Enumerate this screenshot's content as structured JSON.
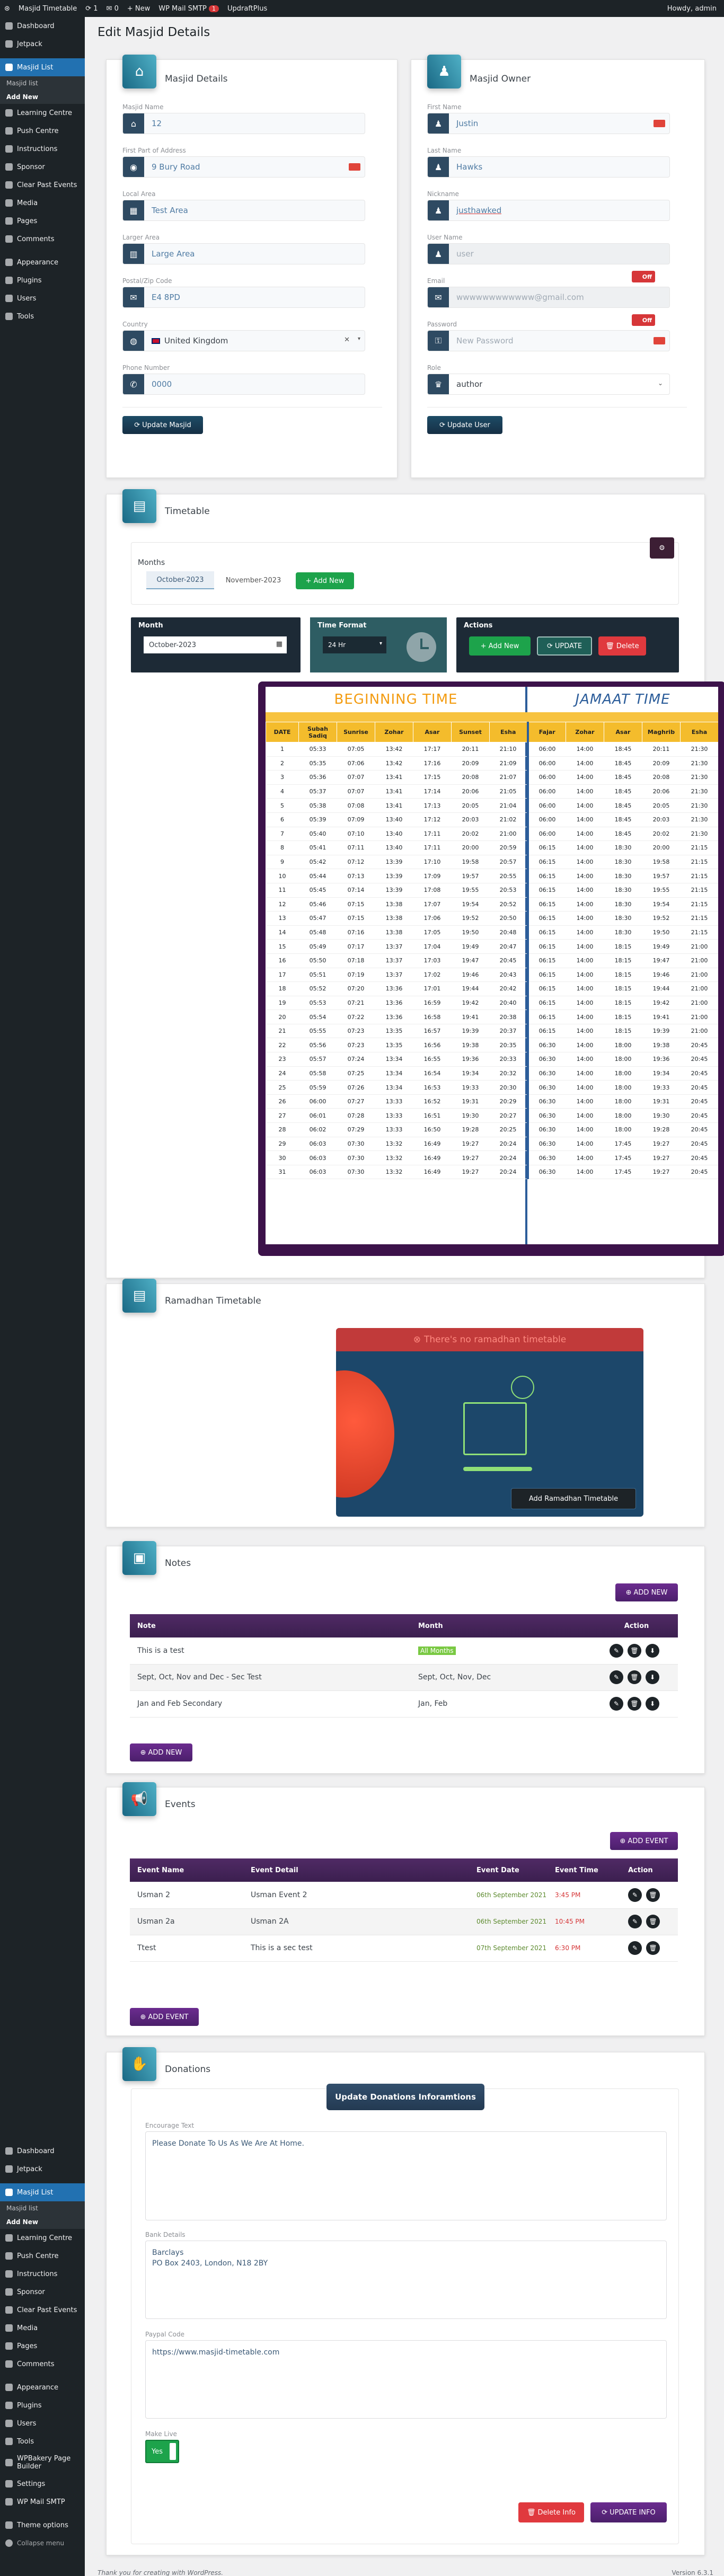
{
  "adminbar": {
    "site": "Masjid Timetable",
    "updates": "1",
    "comments": "0",
    "new": "+ New",
    "smtp": "WP Mail SMTP",
    "smtp_badge": "1",
    "updraft": "UpdraftPlus",
    "howdy": "Howdy, admin"
  },
  "sidebar": {
    "top": [
      "Dashboard",
      "Jetpack"
    ],
    "active": "Masjid List",
    "sub": [
      "Masjid list",
      "Add New"
    ],
    "items": [
      "Learning Centre",
      "Push Centre",
      "Instructions",
      "Sponsor",
      "Clear Past Events",
      "Media",
      "Pages",
      "Comments"
    ],
    "items2": [
      "Appearance",
      "Plugins",
      "Users",
      "Tools"
    ],
    "bottom": {
      "top": [
        "Dashboard",
        "Jetpack"
      ],
      "active": "Masjid List",
      "sub": [
        "Masjid list",
        "Add New"
      ],
      "items": [
        "Learning Centre",
        "Push Centre",
        "Instructions",
        "Sponsor",
        "Clear Past Events",
        "Media",
        "Pages",
        "Comments"
      ],
      "items2": [
        "Appearance",
        "Plugins",
        "Users",
        "Tools",
        "WPBakery Page Builder",
        "Settings",
        "WP Mail SMTP",
        "Theme options"
      ],
      "collapse": "Collapse menu"
    }
  },
  "page_title": "Edit Masjid Details",
  "masjid": {
    "title": "Masjid Details",
    "name_label": "Masjid Name",
    "name": "12",
    "address_label": "First Part of Address",
    "address": "9 Bury Road",
    "local_label": "Local Area",
    "local": "Test Area",
    "larger_label": "Larger Area",
    "larger": "Large Area",
    "postal_label": "Postal/Zip Code",
    "postal": "E4 8PD",
    "country_label": "Country",
    "country": "United Kingdom",
    "phone_label": "Phone Number",
    "phone": "0000",
    "update": "Update Masjid"
  },
  "owner": {
    "title": "Masjid Owner",
    "first_label": "First Name",
    "first": "Justin",
    "last_label": "Last Name",
    "last": "Hawks",
    "nick_label": "Nickname",
    "nick": "justhawked",
    "user_label": "User Name",
    "user": "user",
    "email_label": "Email",
    "email": "wwwwwwwwwwww@gmail.com",
    "password_label": "Password",
    "password": "New Password",
    "role_label": "Role",
    "role": "author",
    "off": "Off",
    "update": "Update User"
  },
  "timetable": {
    "title": "Timetable",
    "months_label": "Months",
    "tabs": [
      "October-2023",
      "November-2023"
    ],
    "add_new": "+ Add New",
    "month_panel": "Month",
    "month_value": "October-2023",
    "tf_panel": "Time Format",
    "tf_value": "24 Hr",
    "actions": "Actions",
    "act_add": "+ Add New",
    "act_update": "UPDATE",
    "act_delete": "Delete",
    "beginning": "BEGINNING TIME",
    "jamaat": "JAMAAT TIME",
    "headers": [
      "DATE",
      "Subah Sadiq",
      "Sunrise",
      "Zohar",
      "Asar",
      "Sunset",
      "Esha",
      "Fajar",
      "Zohar",
      "Asar",
      "Maghrib",
      "Esha"
    ],
    "rows": [
      [
        "1",
        "05:33",
        "07:05",
        "13:42",
        "17:17",
        "20:11",
        "21:10",
        "06:00",
        "14:00",
        "18:45",
        "20:11",
        "21:30"
      ],
      [
        "2",
        "05:35",
        "07:06",
        "13:42",
        "17:16",
        "20:09",
        "21:09",
        "06:00",
        "14:00",
        "18:45",
        "20:09",
        "21:30"
      ],
      [
        "3",
        "05:36",
        "07:07",
        "13:41",
        "17:15",
        "20:08",
        "21:07",
        "06:00",
        "14:00",
        "18:45",
        "20:08",
        "21:30"
      ],
      [
        "4",
        "05:37",
        "07:07",
        "13:41",
        "17:14",
        "20:06",
        "21:05",
        "06:00",
        "14:00",
        "18:45",
        "20:06",
        "21:30"
      ],
      [
        "5",
        "05:38",
        "07:08",
        "13:41",
        "17:13",
        "20:05",
        "21:04",
        "06:00",
        "14:00",
        "18:45",
        "20:05",
        "21:30"
      ],
      [
        "6",
        "05:39",
        "07:09",
        "13:40",
        "17:12",
        "20:03",
        "21:02",
        "06:00",
        "14:00",
        "18:45",
        "20:03",
        "21:30"
      ],
      [
        "7",
        "05:40",
        "07:10",
        "13:40",
        "17:11",
        "20:02",
        "21:00",
        "06:00",
        "14:00",
        "18:45",
        "20:02",
        "21:30"
      ],
      [
        "8",
        "05:41",
        "07:11",
        "13:40",
        "17:11",
        "20:00",
        "20:59",
        "06:15",
        "14:00",
        "18:30",
        "20:00",
        "21:15"
      ],
      [
        "9",
        "05:42",
        "07:12",
        "13:39",
        "17:10",
        "19:58",
        "20:57",
        "06:15",
        "14:00",
        "18:30",
        "19:58",
        "21:15"
      ],
      [
        "10",
        "05:44",
        "07:13",
        "13:39",
        "17:09",
        "19:57",
        "20:55",
        "06:15",
        "14:00",
        "18:30",
        "19:57",
        "21:15"
      ],
      [
        "11",
        "05:45",
        "07:14",
        "13:39",
        "17:08",
        "19:55",
        "20:53",
        "06:15",
        "14:00",
        "18:30",
        "19:55",
        "21:15"
      ],
      [
        "12",
        "05:46",
        "07:15",
        "13:38",
        "17:07",
        "19:54",
        "20:52",
        "06:15",
        "14:00",
        "18:30",
        "19:54",
        "21:15"
      ],
      [
        "13",
        "05:47",
        "07:15",
        "13:38",
        "17:06",
        "19:52",
        "20:50",
        "06:15",
        "14:00",
        "18:30",
        "19:52",
        "21:15"
      ],
      [
        "14",
        "05:48",
        "07:16",
        "13:38",
        "17:05",
        "19:50",
        "20:48",
        "06:15",
        "14:00",
        "18:30",
        "19:50",
        "21:15"
      ],
      [
        "15",
        "05:49",
        "07:17",
        "13:37",
        "17:04",
        "19:49",
        "20:47",
        "06:15",
        "14:00",
        "18:15",
        "19:49",
        "21:00"
      ],
      [
        "16",
        "05:50",
        "07:18",
        "13:37",
        "17:03",
        "19:47",
        "20:45",
        "06:15",
        "14:00",
        "18:15",
        "19:47",
        "21:00"
      ],
      [
        "17",
        "05:51",
        "07:19",
        "13:37",
        "17:02",
        "19:46",
        "20:43",
        "06:15",
        "14:00",
        "18:15",
        "19:46",
        "21:00"
      ],
      [
        "18",
        "05:52",
        "07:20",
        "13:36",
        "17:01",
        "19:44",
        "20:42",
        "06:15",
        "14:00",
        "18:15",
        "19:44",
        "21:00"
      ],
      [
        "19",
        "05:53",
        "07:21",
        "13:36",
        "16:59",
        "19:42",
        "20:40",
        "06:15",
        "14:00",
        "18:15",
        "19:42",
        "21:00"
      ],
      [
        "20",
        "05:54",
        "07:22",
        "13:36",
        "16:58",
        "19:41",
        "20:38",
        "06:15",
        "14:00",
        "18:15",
        "19:41",
        "21:00"
      ],
      [
        "21",
        "05:55",
        "07:23",
        "13:35",
        "16:57",
        "19:39",
        "20:37",
        "06:15",
        "14:00",
        "18:15",
        "19:39",
        "21:00"
      ],
      [
        "22",
        "05:56",
        "07:23",
        "13:35",
        "16:56",
        "19:38",
        "20:35",
        "06:30",
        "14:00",
        "18:00",
        "19:38",
        "20:45"
      ],
      [
        "23",
        "05:57",
        "07:24",
        "13:34",
        "16:55",
        "19:36",
        "20:33",
        "06:30",
        "14:00",
        "18:00",
        "19:36",
        "20:45"
      ],
      [
        "24",
        "05:58",
        "07:25",
        "13:34",
        "16:54",
        "19:34",
        "20:32",
        "06:30",
        "14:00",
        "18:00",
        "19:34",
        "20:45"
      ],
      [
        "25",
        "05:59",
        "07:26",
        "13:34",
        "16:53",
        "19:33",
        "20:30",
        "06:30",
        "14:00",
        "18:00",
        "19:33",
        "20:45"
      ],
      [
        "26",
        "06:00",
        "07:27",
        "13:33",
        "16:52",
        "19:31",
        "20:29",
        "06:30",
        "14:00",
        "18:00",
        "19:31",
        "20:45"
      ],
      [
        "27",
        "06:01",
        "07:28",
        "13:33",
        "16:51",
        "19:30",
        "20:27",
        "06:30",
        "14:00",
        "18:00",
        "19:30",
        "20:45"
      ],
      [
        "28",
        "06:02",
        "07:29",
        "13:33",
        "16:50",
        "19:28",
        "20:25",
        "06:30",
        "14:00",
        "18:00",
        "19:28",
        "20:45"
      ],
      [
        "29",
        "06:03",
        "07:30",
        "13:32",
        "16:49",
        "19:27",
        "20:24",
        "06:30",
        "14:00",
        "17:45",
        "19:27",
        "20:45"
      ],
      [
        "30",
        "06:03",
        "07:30",
        "13:32",
        "16:49",
        "19:27",
        "20:24",
        "06:30",
        "14:00",
        "17:45",
        "19:27",
        "20:45"
      ],
      [
        "31",
        "06:03",
        "07:30",
        "13:32",
        "16:49",
        "19:27",
        "20:24",
        "06:30",
        "14:00",
        "17:45",
        "19:27",
        "20:45"
      ]
    ]
  },
  "ramadhan": {
    "title": "Ramadhan Timetable",
    "empty": "There's no ramadhan timetable",
    "add": "Add Ramadhan Timetable"
  },
  "notes": {
    "title": "Notes",
    "add_top": "ADD NEW",
    "add_bottom": "ADD NEW",
    "headers": [
      "Note",
      "Month",
      "Action"
    ],
    "rows": [
      {
        "note": "This is a test",
        "month": "All Months",
        "badge": true
      },
      {
        "note": "Sept, Oct, Nov and Dec - Sec Test",
        "month": "Sept, Oct, Nov, Dec",
        "badge": false
      },
      {
        "note": "Jan and Feb Secondary",
        "month": "Jan, Feb",
        "badge": false
      }
    ]
  },
  "events": {
    "title": "Events",
    "add_top": "ADD EVENT",
    "add_bottom": "ADD EVENT",
    "headers": [
      "Event Name",
      "Event Detail",
      "Event Date",
      "Event Time",
      "Action"
    ],
    "rows": [
      {
        "name": "Usman 2",
        "detail": "Usman Event 2",
        "date": "06th September 2021",
        "time": "3:45 PM"
      },
      {
        "name": "Usman 2a",
        "detail": "Usman 2A",
        "date": "06th September 2021",
        "time": "10:45 PM"
      },
      {
        "name": "Ttest",
        "detail": "This is a sec test",
        "date": "07th September 2021",
        "time": "6:30 PM"
      }
    ]
  },
  "donations": {
    "title": "Donations",
    "header_btn": "Update Donations Inforamtions",
    "encourage_label": "Encourage Text",
    "encourage": "Please Donate To Us As We Are At Home.",
    "bank_label": "Bank Details",
    "bank": "Barclays\nPO Box 2403, London, N18 2BY",
    "paypal_label": "Paypal Code",
    "paypal": "https://www.masjid-timetable.com",
    "live_label": "Make Live",
    "live": "Yes",
    "delete": "Delete Info",
    "update": "UPDATE INFO"
  },
  "footer": {
    "thanks": "Thank you for creating with WordPress.",
    "version": "Version 6.3.1"
  },
  "colors": {
    "accent": "#2271b1",
    "header": "#502a65",
    "gold": "#f4bc2c",
    "jamaat_blue": "#2c5d9a",
    "event_green": "#5c8a2e",
    "event_red": "#d63638"
  }
}
